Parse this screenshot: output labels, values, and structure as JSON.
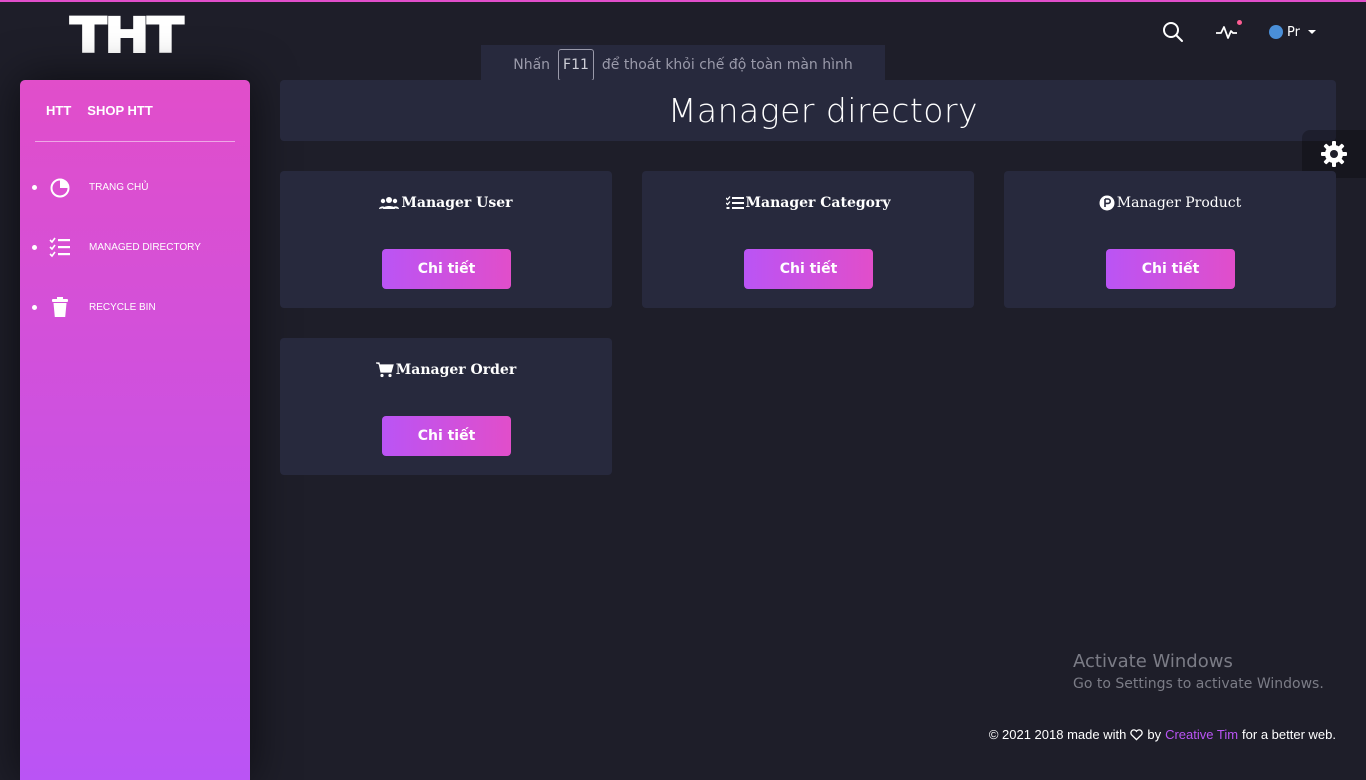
{
  "logo": {
    "text": "THT"
  },
  "fullscreen_banner": {
    "prefix": "Nhấn",
    "key": "F11",
    "suffix": "để thoát khỏi chế độ toàn màn hình"
  },
  "navbar": {
    "search_icon": "search-icon",
    "activity_icon": "activity-icon",
    "profile_alt": "Pr"
  },
  "sidebar": {
    "brand_short": "HTT",
    "brand_full": "SHOP HTT",
    "items": [
      {
        "label": "TRANG CHỦ",
        "icon": "pie-chart-icon"
      },
      {
        "label": "MANAGED DIRECTORY",
        "icon": "checklist-icon"
      },
      {
        "label": "RECYCLE BIN",
        "icon": "trash-icon"
      }
    ]
  },
  "main": {
    "title": "Manager directory",
    "cards": [
      {
        "title": "Manager User",
        "icon": "users-icon",
        "button": "Chi tiết"
      },
      {
        "title": "Manager Category",
        "icon": "list-icon",
        "button": "Chi tiết"
      },
      {
        "title": "Manager Product",
        "icon": "product-icon",
        "button": "Chi tiết"
      },
      {
        "title": "Manager Order",
        "icon": "cart-icon",
        "button": "Chi tiết"
      }
    ]
  },
  "watermark": {
    "line1": "Activate Windows",
    "line2": "Go to Settings to activate Windows."
  },
  "footer": {
    "prefix": "© 2021 2018 made with",
    "by": "by",
    "link": "Creative Tim",
    "suffix": "for a better web."
  },
  "colors": {
    "accent": "#e14eca",
    "accent2": "#ba54f5",
    "background": "#1e1e29",
    "card": "#27293d"
  }
}
